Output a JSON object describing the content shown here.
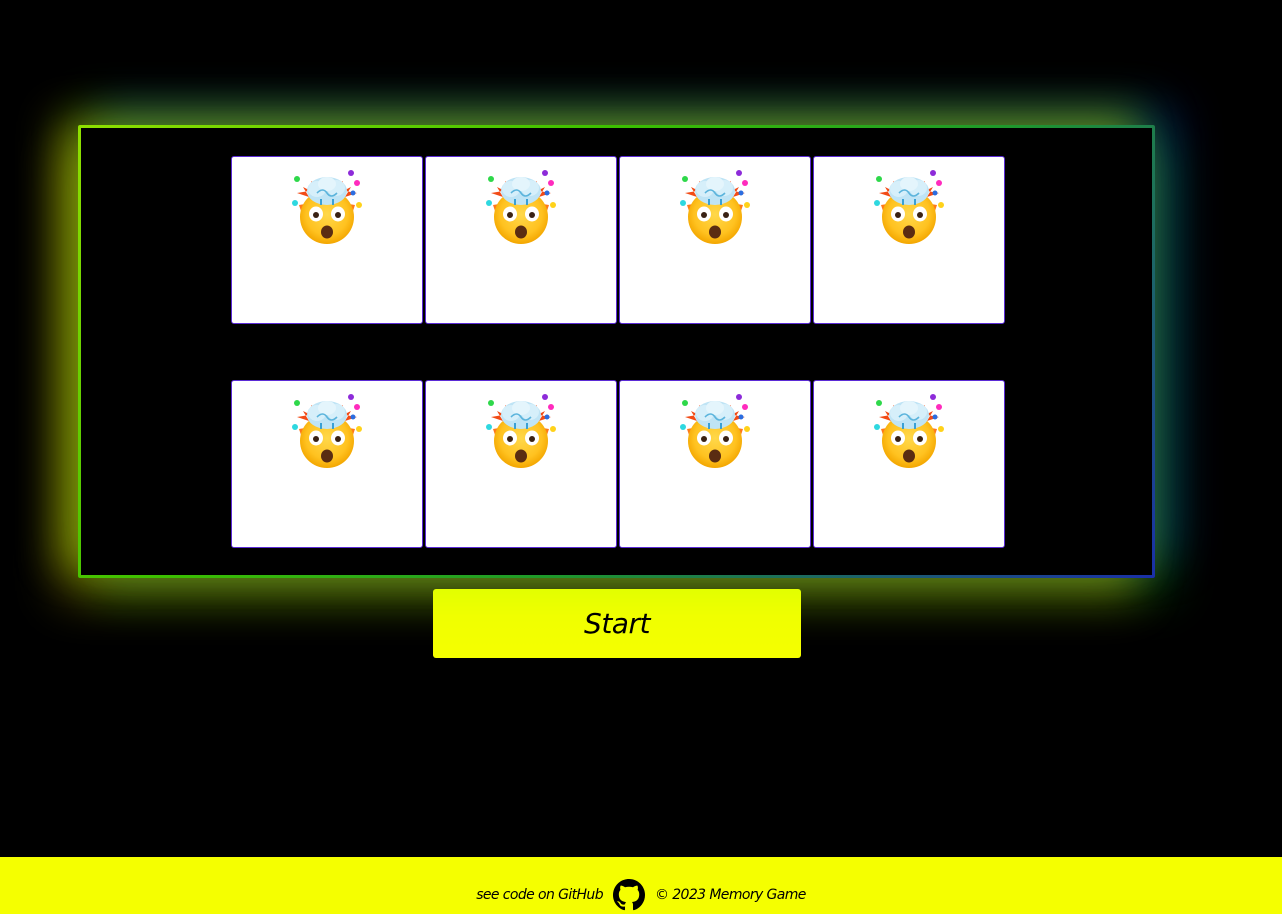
{
  "game": {
    "cards": [
      {
        "icon": "exploding-head-emoji"
      },
      {
        "icon": "exploding-head-emoji"
      },
      {
        "icon": "exploding-head-emoji"
      },
      {
        "icon": "exploding-head-emoji"
      },
      {
        "icon": "exploding-head-emoji"
      },
      {
        "icon": "exploding-head-emoji"
      },
      {
        "icon": "exploding-head-emoji"
      },
      {
        "icon": "exploding-head-emoji"
      }
    ],
    "start_label": "Start"
  },
  "footer": {
    "github_label": "see code on GitHub",
    "github_icon": "github-icon",
    "copyright": "© 2023 Memory Game"
  },
  "colors": {
    "background": "#000000",
    "accent_yellow": "#f5ff00",
    "card_border": "#5b2bd6",
    "frame_green": "#3cc000",
    "frame_blue": "#1a2fa8"
  }
}
